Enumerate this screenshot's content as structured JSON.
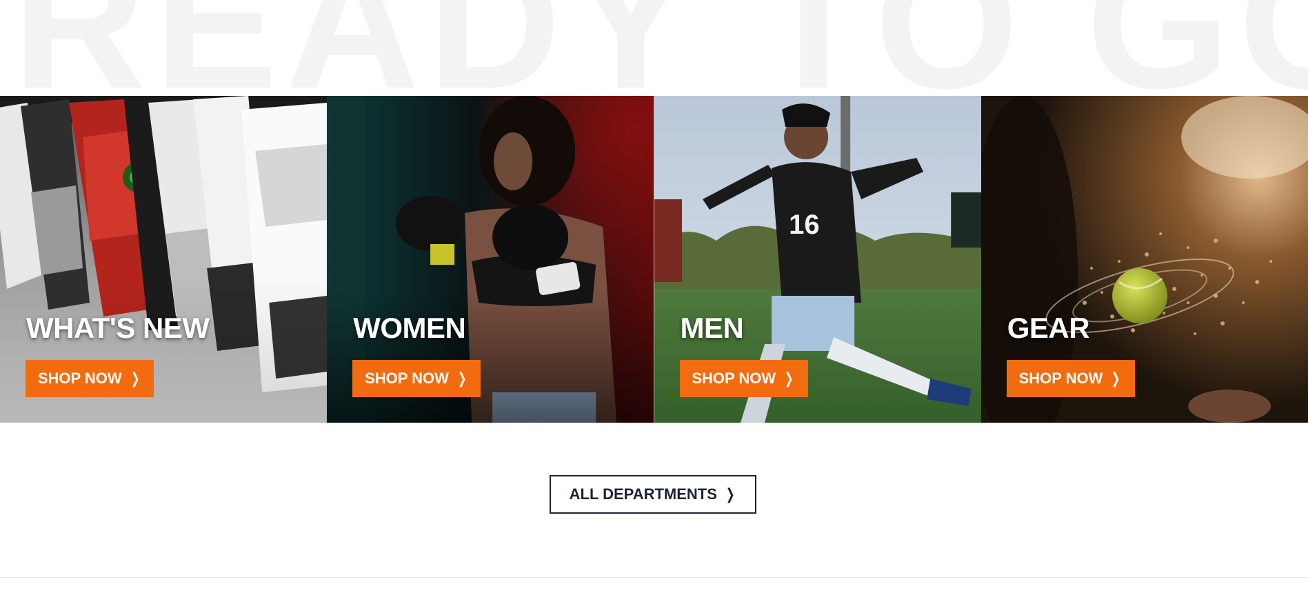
{
  "hero": {
    "background_headline": "READY TO GO"
  },
  "tiles": [
    {
      "title": "WHAT'S NEW",
      "button_label": "SHOP NOW",
      "chevron": "❯",
      "image": "sneakers-photo"
    },
    {
      "title": "WOMEN",
      "button_label": "SHOP NOW",
      "chevron": "❯",
      "image": "boxer-woman-photo"
    },
    {
      "title": "MEN",
      "button_label": "SHOP NOW",
      "chevron": "❯",
      "image": "soccer-player-photo"
    },
    {
      "title": "GEAR",
      "button_label": "SHOP NOW",
      "chevron": "❯",
      "image": "tennis-ball-photo"
    }
  ],
  "all_departments": {
    "label": "ALL DEPARTMENTS",
    "chevron": "❯"
  },
  "colors": {
    "accent": "#f26b0f",
    "text_dark": "#1c2333",
    "background_headline": "#f3f3f3"
  }
}
